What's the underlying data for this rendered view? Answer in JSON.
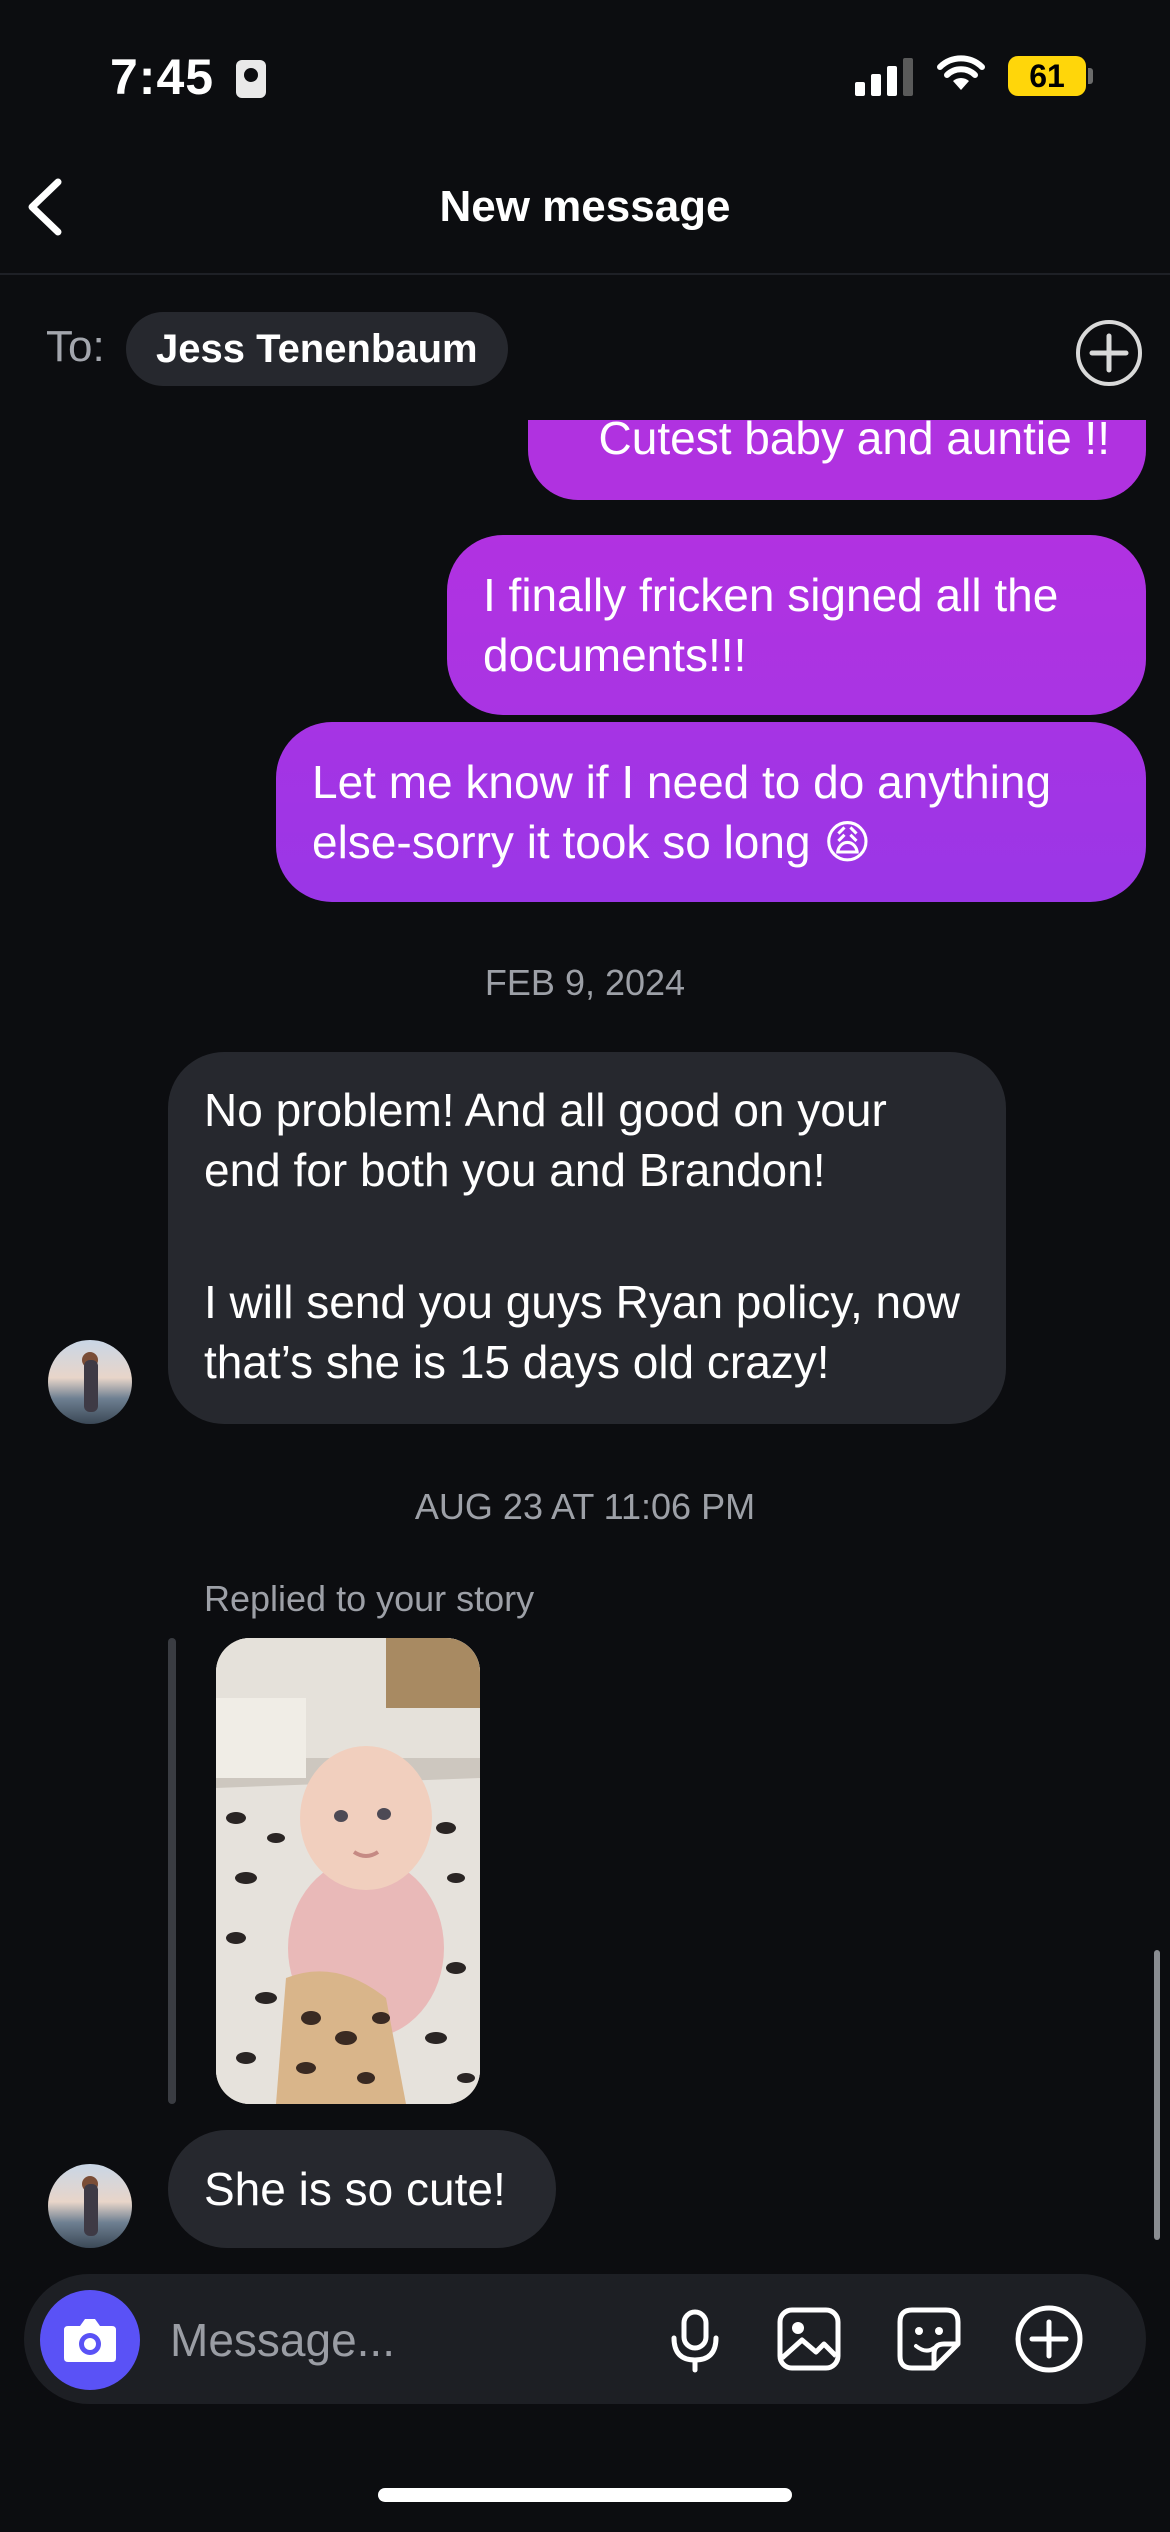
{
  "status_bar": {
    "time": "7:45",
    "battery": "61"
  },
  "header": {
    "title": "New message"
  },
  "recipient": {
    "to_label": "To:",
    "name": "Jess Tenenbaum"
  },
  "messages": {
    "out1": "Cutest baby and auntie !!",
    "out2": "I finally fricken signed all the documents!!!",
    "out3": "Let me know if I need to do anything else-sorry it took so long 😩",
    "date1": "FEB 9, 2024",
    "in1_p1": "No problem! And all good on your end for both you and Brandon!",
    "in1_p2": "I will send you guys Ryan policy, now that’s she is 15 days old crazy!",
    "date2": "AUG 23 AT 11:06 PM",
    "reply_label": "Replied to your story",
    "in2": "She is so cute!"
  },
  "composer": {
    "placeholder": "Message..."
  },
  "colors": {
    "accent": "#5a52f6",
    "bubble_out_top": "#b132e1",
    "bubble_out_bottom": "#9a36e6",
    "bubble_in": "#26282e",
    "battery": "#ffd60a"
  }
}
